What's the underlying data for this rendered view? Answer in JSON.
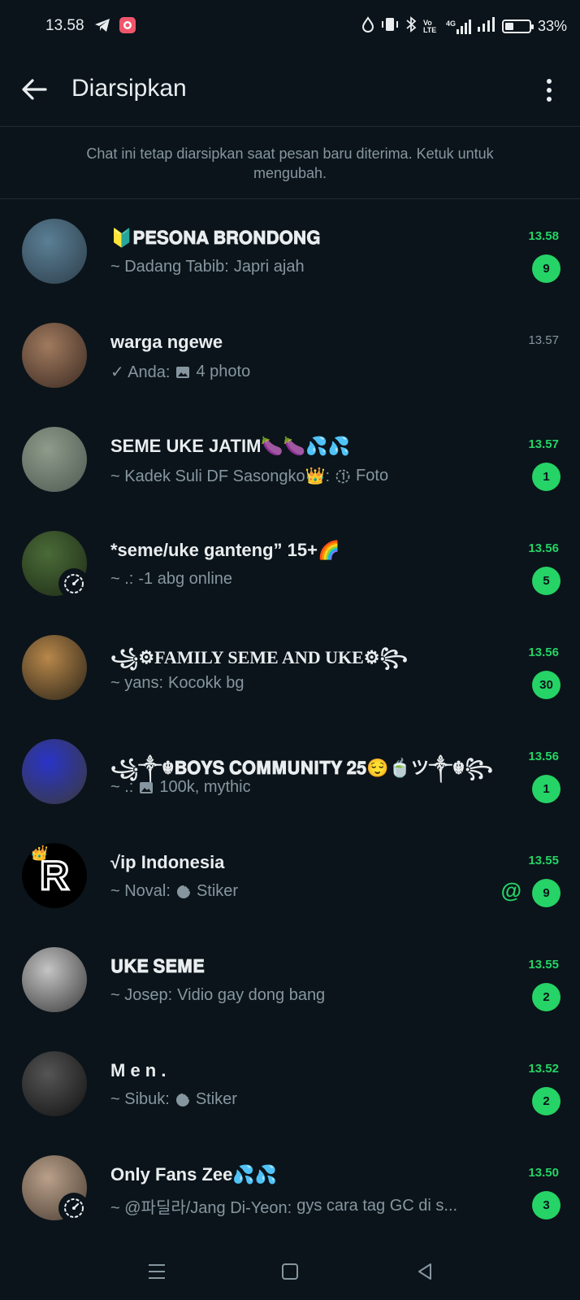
{
  "status_bar": {
    "time": "13.58",
    "left_icons": [
      "telegram-icon",
      "app-notification-icon"
    ],
    "right_icons": [
      "data-saver-icon",
      "vibrate-icon",
      "bluetooth-icon",
      "volte-icon",
      "4g-signal-icon",
      "signal-icon",
      "battery-icon"
    ],
    "volte_text": "Vo LTE",
    "network_text": "4G",
    "battery_percent": "33%",
    "battery_level": 0.33
  },
  "appbar": {
    "title": "Diarsipkan",
    "back_icon": "arrow-left-icon",
    "menu_icon": "more-vertical-icon"
  },
  "notice": {
    "text": "Chat ini tetap diarsipkan saat pesan baru diterima. Ketuk untuk mengubah."
  },
  "colors": {
    "background": "#0b141a",
    "accent": "#25d366",
    "secondary_text": "#8696a0",
    "primary_text": "#e9edef"
  },
  "chats": [
    {
      "name": "🔰𝐏𝐄𝐒𝐎𝐍𝐀 𝐁𝐑𝐎𝐍𝐃𝐎𝐍𝐆",
      "time": "13.58",
      "time_unread": true,
      "sender": "~ Dadang Tabib:",
      "message": "Japri ajah",
      "icon": "",
      "unread": "9",
      "mention": "",
      "avatar_colors": [
        "#5b7f95",
        "#2c3e4a"
      ],
      "status_badge": false
    },
    {
      "name": "warga ngewe",
      "time": "13.57",
      "time_unread": false,
      "sender": "✓ Anda:",
      "message": "4 photo",
      "icon": "image-icon",
      "unread": "",
      "mention": "",
      "avatar_colors": [
        "#a07a5e",
        "#3b2a22"
      ],
      "status_badge": false
    },
    {
      "name": "SEME UKE JATIM🍆🍆💦💦",
      "time": "13.57",
      "time_unread": true,
      "sender": "~ Kadek Suli DF Sasongko👑:",
      "message": "Foto",
      "icon": "view-once-icon",
      "unread": "1",
      "mention": "",
      "avatar_colors": [
        "#8f9b8a",
        "#4d5a52"
      ],
      "status_badge": false
    },
    {
      "name": "*seme/uke ganteng” 15+🌈",
      "time": "13.56",
      "time_unread": true,
      "sender": "~ .:",
      "message": "-1 abg online",
      "icon": "",
      "unread": "5",
      "mention": "",
      "avatar_colors": [
        "#4a6b38",
        "#1e2b16"
      ],
      "status_badge": true
    },
    {
      "name": "꧁⚙FAMILY SEME AND UKE⚙꧂",
      "time": "13.56",
      "time_unread": true,
      "sender": "~ yans:",
      "message": "Kocokk bg",
      "icon": "",
      "unread": "30",
      "mention": "",
      "avatar_colors": [
        "#b8874a",
        "#2a2418"
      ],
      "status_badge": false
    },
    {
      "name": "꧁༒☬𝐁𝐎𝐘𝐒 𝐂𝐎𝐌𝐌𝐔𝐍𝐈𝐓𝐘 𝟐𝟓😌🍵ツ༒☬꧂",
      "time": "13.56",
      "time_unread": true,
      "sender": "~ .:",
      "message": "100k, mythic",
      "icon": "image-icon",
      "unread": "1",
      "mention": "",
      "avatar_colors": [
        "#2a34c8",
        "#3a3a3a"
      ],
      "status_badge": false
    },
    {
      "name": "√ip Indonesia",
      "time": "13.55",
      "time_unread": true,
      "sender": "~ Noval:",
      "message": "Stiker",
      "icon": "sticker-icon",
      "unread": "9",
      "mention": "@",
      "avatar_colors": [
        "#000000",
        "#000000"
      ],
      "avatar_letter": "R",
      "status_badge": false
    },
    {
      "name": "𝐔𝐊𝐄 𝐒𝐄𝐌𝐄",
      "time": "13.55",
      "time_unread": true,
      "sender": "~ Josep:",
      "message": "Vidio gay dong bang",
      "icon": "",
      "unread": "2",
      "mention": "",
      "avatar_colors": [
        "#c4c4c4",
        "#3a3a3a"
      ],
      "status_badge": false
    },
    {
      "name": "M e n .",
      "time": "13.52",
      "time_unread": true,
      "sender": "~ Sibuk:",
      "message": "Stiker",
      "icon": "sticker-icon",
      "unread": "2",
      "mention": "",
      "avatar_colors": [
        "#555555",
        "#111111"
      ],
      "status_badge": false
    },
    {
      "name": "Only Fans Zee💦💦",
      "time": "13.50",
      "time_unread": true,
      "sender": "~ @파딜라/Jang Di-Yeon:",
      "message": "gys cara tag GC di s...",
      "icon": "",
      "unread": "3",
      "mention": "",
      "avatar_colors": [
        "#b9a08a",
        "#4a3d33"
      ],
      "status_badge": true
    }
  ],
  "navbar": {
    "icons": [
      "recents-icon",
      "home-icon",
      "back-triangle-icon"
    ]
  }
}
